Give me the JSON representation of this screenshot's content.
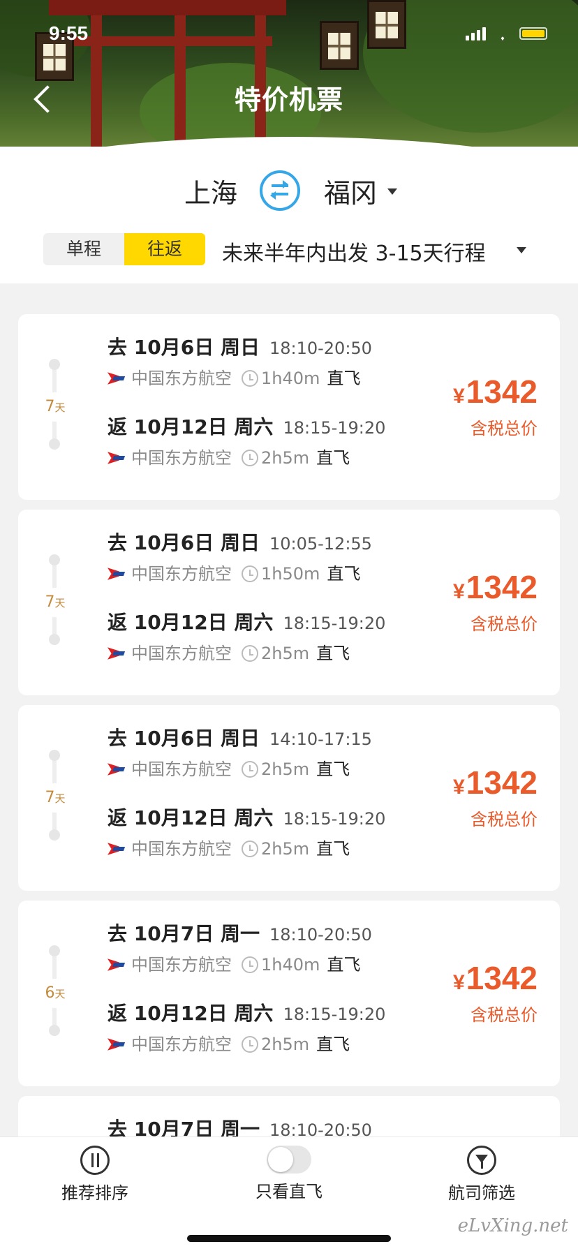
{
  "status_bar": {
    "time": "9:55"
  },
  "header": {
    "title": "特价机票"
  },
  "route": {
    "from": "上海",
    "to": "福冈"
  },
  "trip_type": {
    "one_way": "单程",
    "round_trip": "往返",
    "selected": "往返"
  },
  "period": "未来半年内出发 3-15天行程",
  "cards": [
    {
      "days": "7",
      "days_unit": "天",
      "out": {
        "date": "去 10月6日 周日",
        "time": "18:10-20:50",
        "airline": "中国东方航空",
        "duration": "1h40m",
        "direct": "直飞"
      },
      "ret": {
        "date": "返 10月12日 周六",
        "time": "18:15-19:20",
        "airline": "中国东方航空",
        "duration": "2h5m",
        "direct": "直飞"
      },
      "currency": "¥",
      "price": "1342",
      "price_note": "含税总价"
    },
    {
      "days": "7",
      "days_unit": "天",
      "out": {
        "date": "去 10月6日 周日",
        "time": "10:05-12:55",
        "airline": "中国东方航空",
        "duration": "1h50m",
        "direct": "直飞"
      },
      "ret": {
        "date": "返 10月12日 周六",
        "time": "18:15-19:20",
        "airline": "中国东方航空",
        "duration": "2h5m",
        "direct": "直飞"
      },
      "currency": "¥",
      "price": "1342",
      "price_note": "含税总价"
    },
    {
      "days": "7",
      "days_unit": "天",
      "out": {
        "date": "去 10月6日 周日",
        "time": "14:10-17:15",
        "airline": "中国东方航空",
        "duration": "2h5m",
        "direct": "直飞"
      },
      "ret": {
        "date": "返 10月12日 周六",
        "time": "18:15-19:20",
        "airline": "中国东方航空",
        "duration": "2h5m",
        "direct": "直飞"
      },
      "currency": "¥",
      "price": "1342",
      "price_note": "含税总价"
    },
    {
      "days": "6",
      "days_unit": "天",
      "out": {
        "date": "去 10月7日 周一",
        "time": "18:10-20:50",
        "airline": "中国东方航空",
        "duration": "1h40m",
        "direct": "直飞"
      },
      "ret": {
        "date": "返 10月12日 周六",
        "time": "18:15-19:20",
        "airline": "中国东方航空",
        "duration": "2h5m",
        "direct": "直飞"
      },
      "currency": "¥",
      "price": "1342",
      "price_note": "含税总价"
    },
    {
      "out": {
        "date": "去 10月7日 周一",
        "time": "18:10-20:50"
      }
    }
  ],
  "bottom_bar": {
    "sort": "推荐排序",
    "direct_only": "只看直飞",
    "airline_filter": "航司筛选"
  },
  "watermark": "eLvXing.net",
  "colors": {
    "accent_yellow": "#ffd800",
    "price_orange": "#ea5b2c",
    "swap_blue": "#35a7e6",
    "days_gold": "#c48a3c"
  }
}
